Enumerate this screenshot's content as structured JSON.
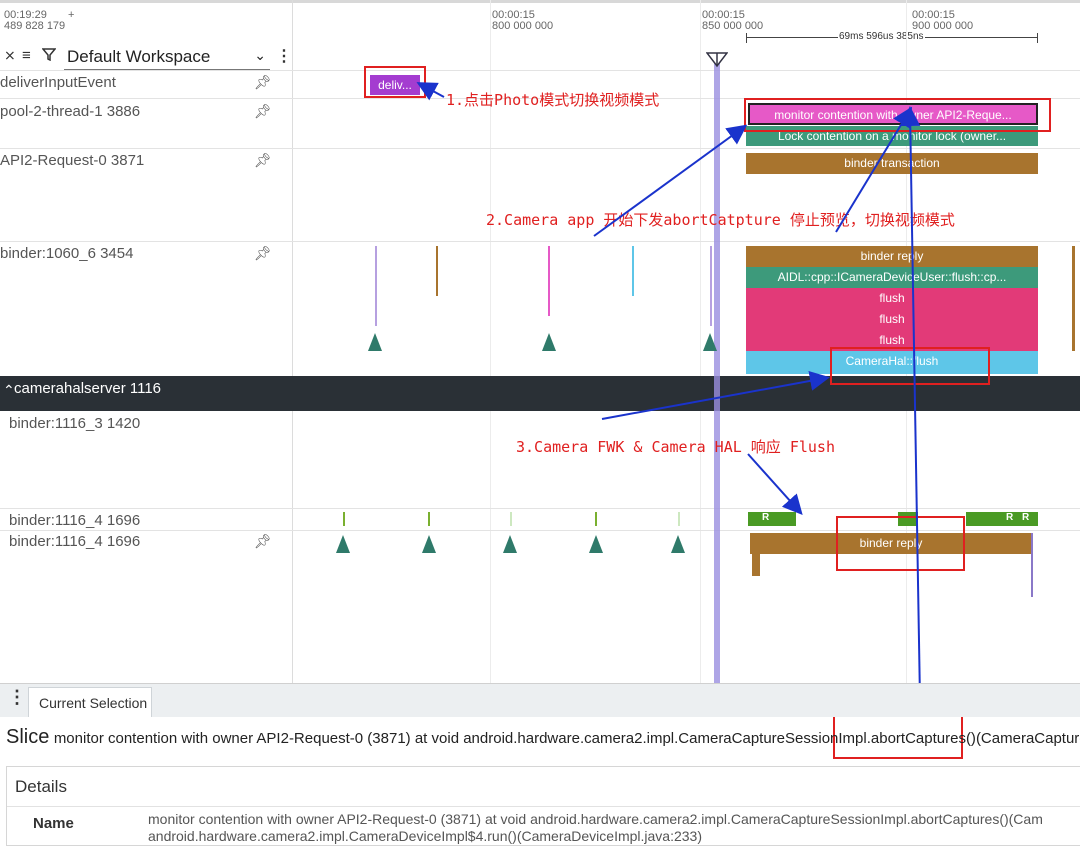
{
  "timeline": {
    "left_time": "00:19:29",
    "left_ns": "489 828 179",
    "plus": "+",
    "markers": [
      {
        "time": "00:00:15",
        "ns": "800 000 000"
      },
      {
        "time": "00:00:15",
        "ns": "850 000 000"
      },
      {
        "time": "00:00:15",
        "ns": "900 000 000"
      }
    ],
    "span_label": "69ms 596us 385ns"
  },
  "toolbar": {
    "collapse_icon": "collapse-icon",
    "menu_icon": "menu-icon",
    "filter_icon": "filter-icon",
    "workspace": "Default Workspace",
    "more_icon": "vertical-dots-icon"
  },
  "tracks": {
    "deliver": "deliverInputEvent",
    "pool": "pool-2-thread-1 3886",
    "api2": "API2-Request-0 3871",
    "binder1060": "binder:1060_6 3454",
    "camerahal_group": "camerahalserver 1116",
    "b1116_3": "binder:1116_3 1420",
    "b1116_4a": "binder:1116_4 1696",
    "b1116_4b": "binder:1116_4 1696"
  },
  "slices": {
    "deliv": "deliv...",
    "monitor": "monitor contention with owner API2-Reque...",
    "lock": "Lock contention on a monitor lock (owner...",
    "binder_tx": "binder transaction",
    "binder_reply": "binder reply",
    "aidl": "AIDL::cpp::ICameraDeviceUser::flush::cp...",
    "flush1": "flush",
    "flush2": "flush",
    "flush3": "flush",
    "camerahal_flush": "CameraHal::flush",
    "r1": "R",
    "r2": "R",
    "r3": "R",
    "binder_reply2": "binder reply"
  },
  "annotations": {
    "a1": "1.点击Photo模式切换视频模式",
    "a2": "2.Camera app 开始下发abortCatpture 停止预览，切换视频模式",
    "a3": "3.Camera FWK & Camera HAL 响应 Flush"
  },
  "bottom": {
    "tab": "Current Selection",
    "slice_word": "Slice",
    "slice_text_a": "monitor contention with owner API2-Request-0 (3871) at void android.hardware.camera2.impl.CameraCaptureSessionImpl.abortCaptures()",
    "slice_text_b": "(CameraCaptureSe",
    "details": "Details",
    "name_label": "Name",
    "name_value": "monitor contention with owner API2-Request-0 (3871) at void android.hardware.camera2.impl.CameraCaptureSessionImpl.abortCaptures()(Cam",
    "name_value2": "android.hardware.camera2.impl.CameraDeviceImpl$4.run()(CameraDeviceImpl.java:233)"
  },
  "colors": {
    "purple": "#a43cd0",
    "magenta": "#e659c7",
    "teal": "#3d9a7b",
    "brown": "#a8742e",
    "pink": "#e23a78",
    "cyan": "#5ec6e8",
    "group_bg": "#2a3036",
    "annotation": "#e02020"
  }
}
